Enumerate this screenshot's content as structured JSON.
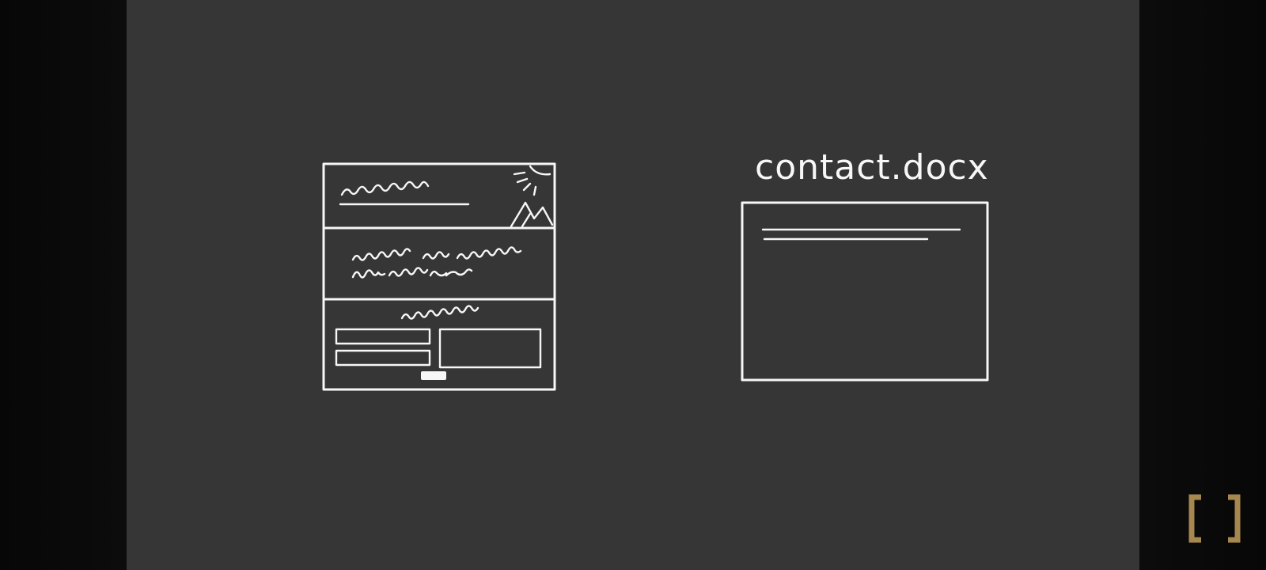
{
  "document": {
    "filename": "contact.docx"
  },
  "icons": {
    "fullscreen": "fullscreen-bracket-icon",
    "sun": "sun-icon",
    "mountains": "mountains-icon"
  },
  "colors": {
    "panel_background": "#363636",
    "outer_background": "#0a0a0a",
    "sketch_stroke": "#f7f7f7",
    "fullscreen_accent": "#a5874f"
  }
}
